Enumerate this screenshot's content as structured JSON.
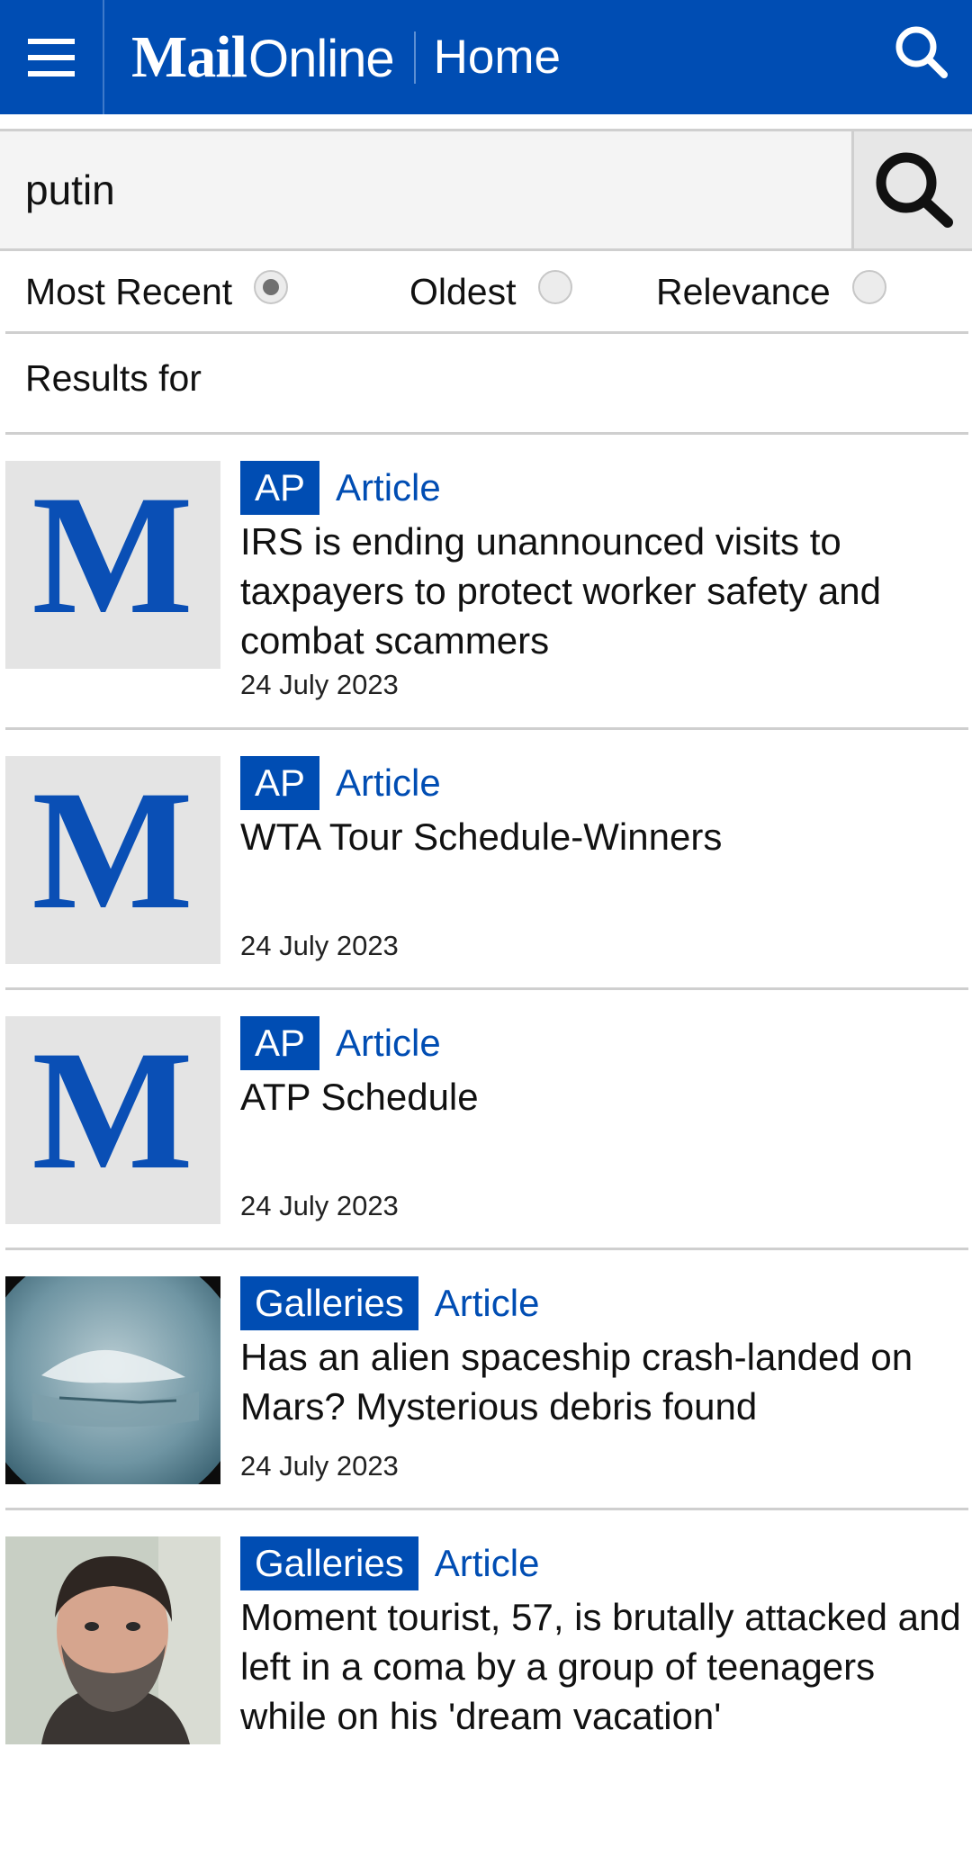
{
  "header": {
    "logo_mail": "Mail",
    "logo_online": "Online",
    "section": "Home",
    "menu_icon": "hamburger-menu-icon",
    "search_icon": "search-icon"
  },
  "search": {
    "value": "putin",
    "button_icon": "search-icon"
  },
  "sort": {
    "options": [
      {
        "label": "Most Recent",
        "checked": true
      },
      {
        "label": "Oldest",
        "checked": false
      },
      {
        "label": "Relevance",
        "checked": false
      }
    ]
  },
  "results_label": "Results for",
  "results": [
    {
      "tag": "AP",
      "type": "Article",
      "title": "IRS is ending unannounced visits to taxpayers to protect worker safety and combat scammers",
      "date": "24 July 2023",
      "thumb": "dailymail-m-logo"
    },
    {
      "tag": "AP",
      "type": "Article",
      "title": "WTA Tour Schedule-Winners",
      "date": "24 July 2023",
      "thumb": "dailymail-m-logo"
    },
    {
      "tag": "AP",
      "type": "Article",
      "title": "ATP Schedule",
      "date": "24 July 2023",
      "thumb": "dailymail-m-logo"
    },
    {
      "tag": "Galleries",
      "type": "Article",
      "title": "Has an alien spaceship crash-landed on Mars? Mysterious debris found",
      "date": "24 July 2023",
      "thumb": "mars-debris-photo"
    },
    {
      "tag": "Galleries",
      "type": "Article",
      "title": "Moment tourist, 57, is brutally attacked and left in a coma by a group of teenagers while on his 'dream vacation'",
      "date": "",
      "thumb": "man-portrait-photo"
    }
  ],
  "colors": {
    "brand_blue": "#004db3",
    "divider": "#cfcfcf"
  }
}
